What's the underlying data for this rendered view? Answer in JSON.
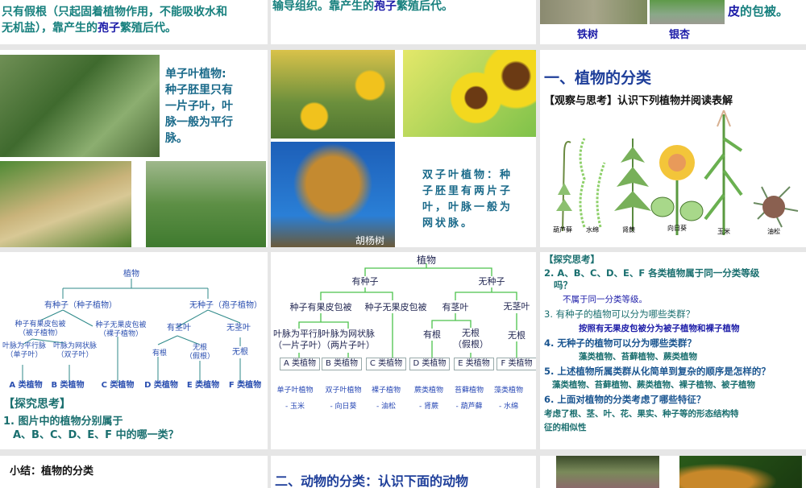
{
  "row0": {
    "s1": {
      "line1": "只有假根（只起固着植物作用，不能吸收水和",
      "line2_a": "无机盐），靠产生的",
      "line2_b": "孢子",
      "line2_c": "繁殖后代。"
    },
    "s2": {
      "a": "输导组织。靠产生的",
      "b": "孢子",
      "c": "繁殖后代。"
    },
    "s3": {
      "label1": "铁树",
      "label2": "银杏",
      "text_a": "皮",
      "text_b": "的包被。"
    }
  },
  "row1": {
    "s1": {
      "text": [
        "单子叶植物:",
        "种子胚里只有",
        "一片子叶，叶",
        "脉一般为平行",
        "脉。"
      ]
    },
    "s2": {
      "caption": "胡杨树",
      "text": [
        "双子叶植物：种",
        "子胚里有两片子",
        "叶，叶脉一般为",
        "网状脉。"
      ]
    },
    "s3": {
      "title": "一、植物的分类",
      "subtitle": "【观察与思考】认识下列植物并阅读表解",
      "plants": [
        "葫芦藓",
        "水绵",
        "肾蕨",
        "向日葵",
        "玉米",
        "油松"
      ]
    }
  },
  "row2": {
    "s1": {
      "root": "植物",
      "seed": "有种子（种子植物）",
      "noseed": "无种子（孢子植物）",
      "ang1": "种子有果皮包被",
      "ang2": "（被子植物）",
      "gym1": "种子无果皮包被",
      "gym2": "（裸子植物）",
      "stem": "有茎叶",
      "nostem": "无茎叶",
      "par1": "叶脉为平行脉",
      "par2": "（单子叶）",
      "net1": "叶脉为网状脉",
      "net2": "（双子叶）",
      "root_yes": "有根",
      "root_no1": "无根",
      "root_no2": "（假根）",
      "root_no3": "无根",
      "classes": [
        "A 类植物",
        "B 类植物",
        "C 类植物",
        "D 类植物",
        "E 类植物",
        "F 类植物"
      ],
      "heading": "【探究思考】",
      "q1": "1. 图片中的植物分别属于",
      "q1b": "A、B、C、D、E、F 中的哪一类？"
    },
    "s2": {
      "root": "植物",
      "seed": "有种子",
      "noseed": "无种子",
      "ang": "种子有果皮包被",
      "gym": "种子无果皮包被",
      "stem": "有茎叶",
      "nostem": "无茎叶",
      "par1": "叶脉为平行脉",
      "par2": "（一片子叶）",
      "net1": "叶脉为网状脉",
      "net2": "（两片子叶）",
      "root_yes": "有根",
      "root_no1": "无根",
      "root_no2": "（假根）",
      "root_no3": "无根",
      "classes": [
        "A 类植物",
        "B 类植物",
        "C 类植物",
        "D 类植物",
        "E 类植物",
        "F 类植物"
      ],
      "groups": [
        "单子叶植物",
        "双子叶植物",
        "裸子植物",
        "蕨类植物",
        "苔藓植物",
        "藻类植物"
      ],
      "examples": [
        "- 玉米",
        "- 向日葵",
        "- 油松",
        "- 肾蕨",
        "- 葫芦藓",
        "- 水绵"
      ]
    },
    "s3": {
      "heading": "【探究思考】",
      "q2": "2. A、B、C、D、E、F 各类植物属于同一分类等级",
      "q2b": "吗？",
      "a2": "不属于同一分类等级。",
      "q3": "3. 有种子的植物可以分为哪些类群？",
      "a3": "按照有无果皮包被分为被子植物和裸子植物",
      "q4": "4. 无种子的植物可以分为哪些类群？",
      "a4": "藻类植物、苔藓植物、蕨类植物",
      "q5": "5. 上述植物所属类群从化简单到复杂的顺序是怎样的？",
      "a5": "藻类植物、苔藓植物、蕨类植物、裸子植物、被子植物",
      "q6": "6. 上面对植物的分类考虑了哪些特征？",
      "a6a": "考虑了根、茎、叶、花、果实、种子等的形态结构特",
      "a6b": "征的相似性"
    }
  },
  "row3": {
    "s1": {
      "title": "小结：植物的分类"
    },
    "s2": {
      "title": "二、动物的分类：认识下面的动物"
    }
  },
  "colors": {
    "teal": "#17807e",
    "blue": "#1c1ca8",
    "bg": "#e6e6e6"
  }
}
